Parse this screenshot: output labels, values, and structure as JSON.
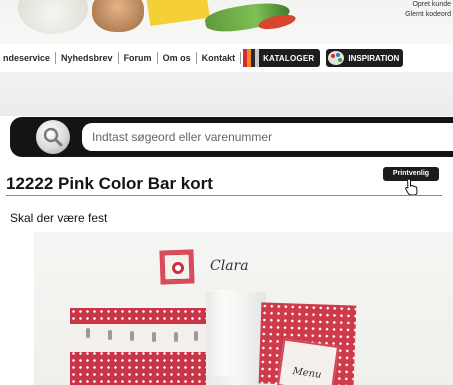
{
  "header": {
    "links": [
      "Opret kunde",
      "Glemt kodeord"
    ]
  },
  "nav": {
    "items": [
      "ndeservice",
      "Nyhedsbrev",
      "Forum",
      "Om os",
      "Kontakt"
    ],
    "catalog_label": "KATALOGER",
    "inspiration_label": "INSPIRATION",
    "book_colors": [
      "#d22a3a",
      "#ef8b22",
      "#2a2a2a",
      "#c9c9c9"
    ]
  },
  "search": {
    "placeholder": "Indtast søgeord eller varenummer",
    "icon": "search-icon"
  },
  "product": {
    "title": "12222 Pink Color Bar kort",
    "print_label": "Printvenlig",
    "subheading": "Skal der være fest"
  },
  "photo": {
    "tag_text": "Clara",
    "menu_text": "Menu"
  },
  "colors": {
    "dark_bar": "#141414",
    "card_red": "#ce3a4a"
  }
}
